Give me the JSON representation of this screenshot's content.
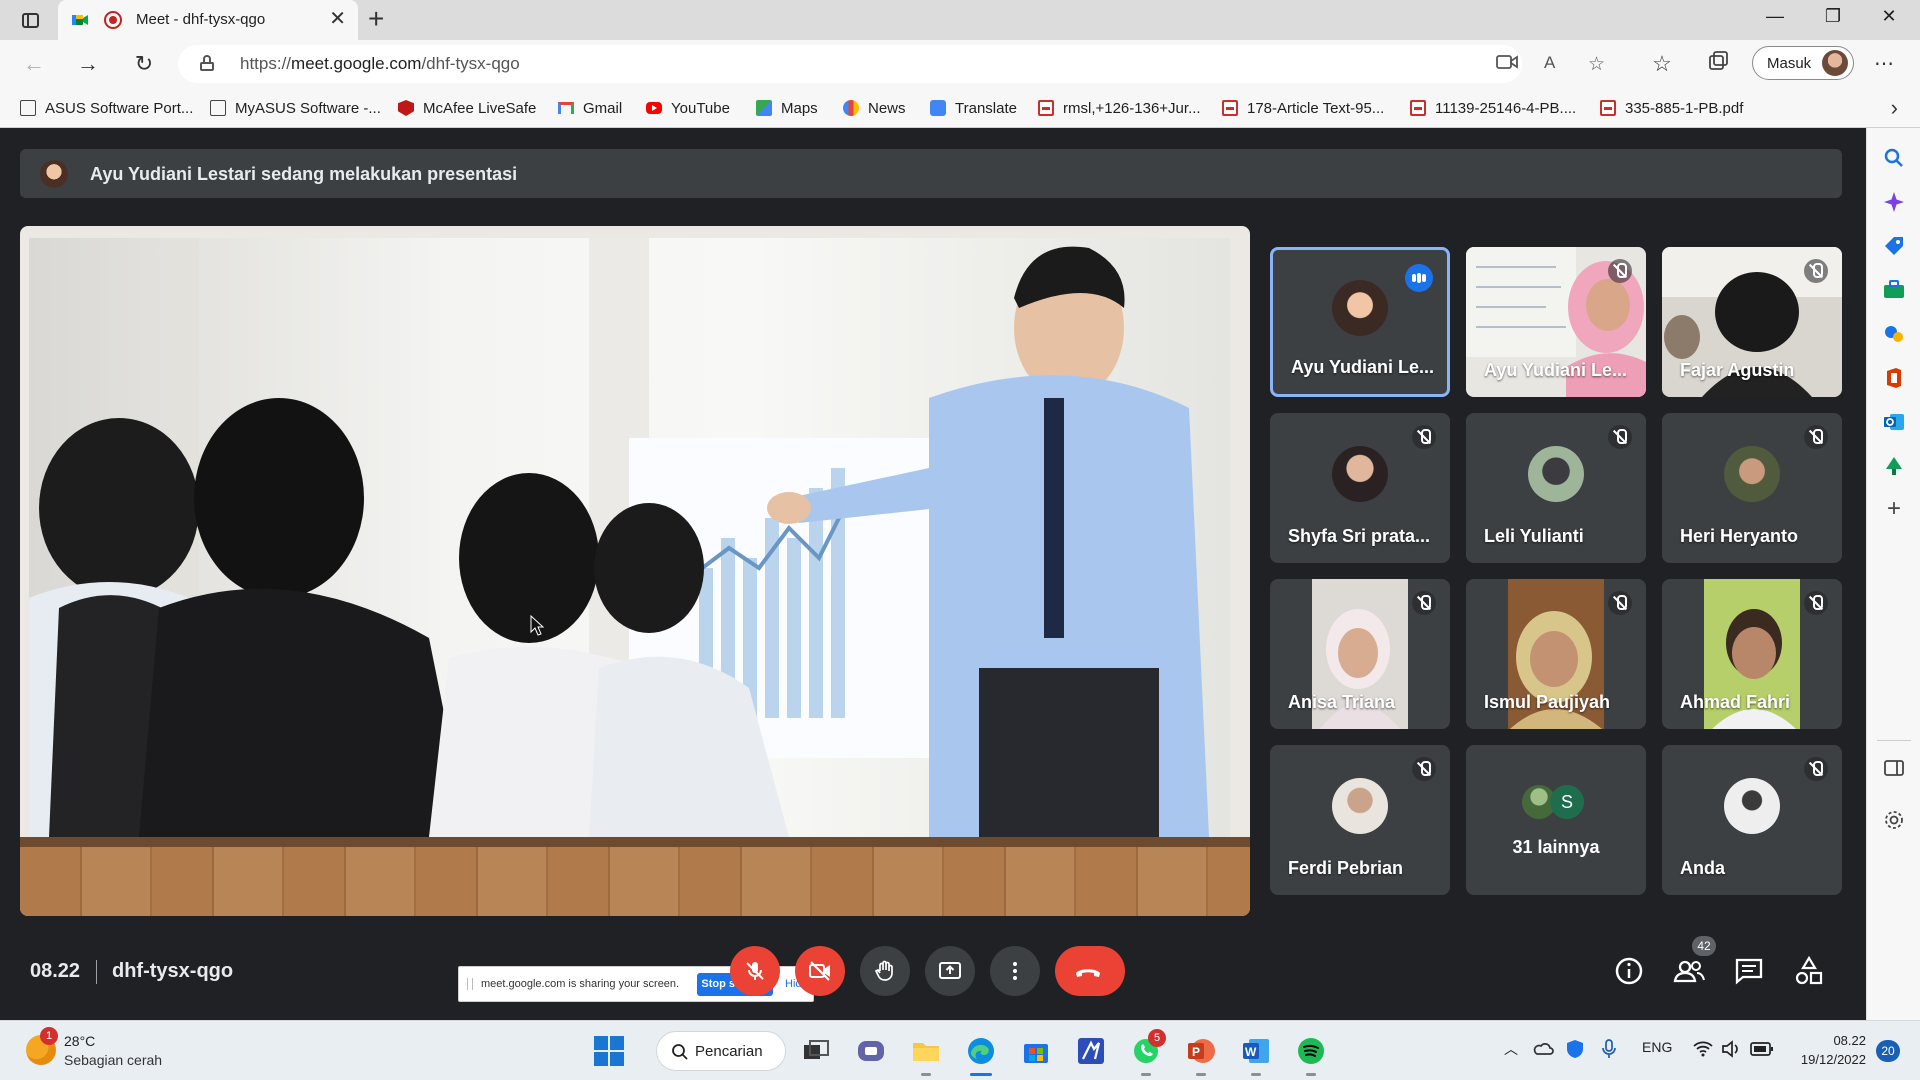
{
  "browser": {
    "tab_title": "Meet - dhf-tysx-qgo",
    "url_prefix": "https://",
    "url_domain": "meet.google.com",
    "url_path": "/dhf-tysx-qgo",
    "profile_label": "Masuk",
    "bookmarks": [
      {
        "label": "ASUS Software Port...",
        "icon": "doc-icon"
      },
      {
        "label": "MyASUS Software -...",
        "icon": "doc-icon"
      },
      {
        "label": "McAfee LiveSafe",
        "icon": "mcafee-icon"
      },
      {
        "label": "Gmail",
        "icon": "gmail-icon"
      },
      {
        "label": "YouTube",
        "icon": "youtube-icon"
      },
      {
        "label": "Maps",
        "icon": "maps-icon"
      },
      {
        "label": "News",
        "icon": "news-icon"
      },
      {
        "label": "Translate",
        "icon": "translate-icon"
      },
      {
        "label": "rmsl,+126-136+Jur...",
        "icon": "pdf-icon"
      },
      {
        "label": "178-Article Text-95...",
        "icon": "pdf-icon"
      },
      {
        "label": "11139-25146-4-PB....",
        "icon": "pdf-icon"
      },
      {
        "label": "335-885-1-PB.pdf",
        "icon": "pdf-icon"
      }
    ]
  },
  "meet": {
    "presenting_text": "Ayu Yudiani Lestari sedang melakukan presentasi",
    "share_notice": {
      "text": "meet.google.com is sharing your screen.",
      "stop_label": "Stop sharing",
      "hide_label": "Hide"
    },
    "participants": [
      {
        "name": "Ayu Yudiani Le...",
        "state": "speaking",
        "has_video": false
      },
      {
        "name": "Ayu Yudiani Le...",
        "state": "muted",
        "has_video": true
      },
      {
        "name": "Fajar Agustin",
        "state": "muted",
        "has_video": true
      },
      {
        "name": "Shyfa Sri prata...",
        "state": "muted",
        "has_video": false
      },
      {
        "name": "Leli Yulianti",
        "state": "muted",
        "has_video": false
      },
      {
        "name": "Heri Heryanto",
        "state": "muted",
        "has_video": false
      },
      {
        "name": "Anisa Triana",
        "state": "muted",
        "has_video": true
      },
      {
        "name": "Ismul Paujiyah",
        "state": "muted",
        "has_video": true
      },
      {
        "name": "Ahmad Fahri",
        "state": "muted",
        "has_video": true
      },
      {
        "name": "Ferdi Pebrian",
        "state": "muted",
        "has_video": false
      },
      {
        "name": "Anda",
        "state": "muted",
        "has_video": false
      }
    ],
    "more": {
      "initial": "S",
      "label": "31 lainnya"
    },
    "clock": "08.22",
    "meeting_code": "dhf-tysx-qgo",
    "people_count": "42"
  },
  "taskbar": {
    "weather_temp": "28°C",
    "weather_desc": "Sebagian cerah",
    "weather_badge": "1",
    "search_label": "Pencarian",
    "whatsapp_badge": "5",
    "language": "ENG",
    "time": "08.22",
    "date": "19/12/2022",
    "notification_count": "20"
  },
  "colors": {
    "meet_bg": "#202124",
    "tile_bg": "#3c4043",
    "red_control": "#ea4335",
    "active_tile_border": "#8ab4f8"
  }
}
